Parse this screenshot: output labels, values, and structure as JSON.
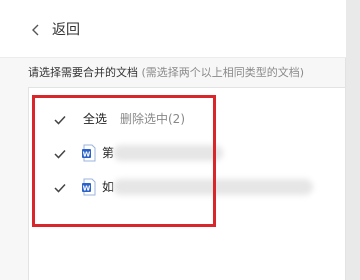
{
  "header": {
    "back_label": "返回"
  },
  "instruction": {
    "main": "请选择需要合并的文档",
    "sub": "(需选择两个以上相同类型的文档)"
  },
  "list": {
    "select_all_label": "全选",
    "delete_selected_label": "删除选中(2)",
    "files": [
      {
        "name": "第",
        "checked": true,
        "icon": "word-doc-icon"
      },
      {
        "name": "如",
        "checked": true,
        "icon": "word-doc-icon"
      }
    ],
    "select_all_checked": true
  },
  "colors": {
    "accent_highlight": "#d8262b",
    "word_blue": "#2b62c9"
  }
}
